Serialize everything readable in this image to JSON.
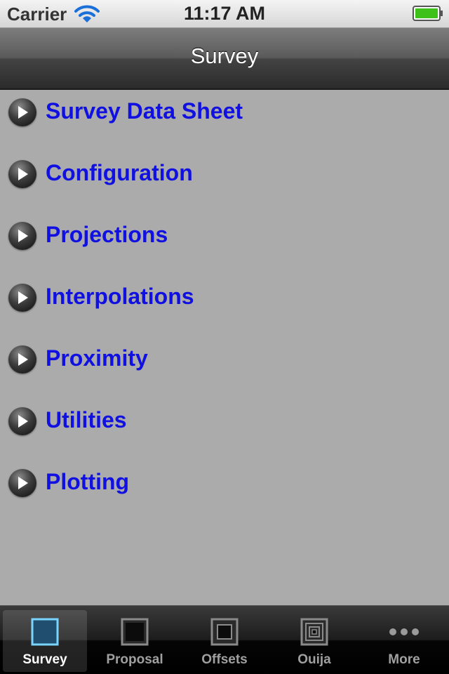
{
  "status_bar": {
    "carrier": "Carrier",
    "time": "11:17 AM",
    "wifi_icon": "wifi-icon",
    "battery_icon": "battery-icon",
    "battery_color": "#3ec21a"
  },
  "nav_bar": {
    "title": "Survey"
  },
  "menu": {
    "link_color": "#1010e0",
    "items": [
      {
        "label": "Survey Data Sheet",
        "icon": "play-icon"
      },
      {
        "label": "Configuration",
        "icon": "play-icon"
      },
      {
        "label": "Projections",
        "icon": "play-icon"
      },
      {
        "label": "Interpolations",
        "icon": "play-icon"
      },
      {
        "label": "Proximity",
        "icon": "play-icon"
      },
      {
        "label": "Utilities",
        "icon": "play-icon"
      },
      {
        "label": "Plotting",
        "icon": "play-icon"
      }
    ]
  },
  "tab_bar": {
    "selected": "Survey",
    "tabs": [
      {
        "label": "Survey",
        "icon": "square-icon"
      },
      {
        "label": "Proposal",
        "icon": "square-icon"
      },
      {
        "label": "Offsets",
        "icon": "nested-square-icon"
      },
      {
        "label": "Ouija",
        "icon": "concentric-square-icon"
      },
      {
        "label": "More",
        "icon": "more-dots-icon"
      }
    ]
  }
}
